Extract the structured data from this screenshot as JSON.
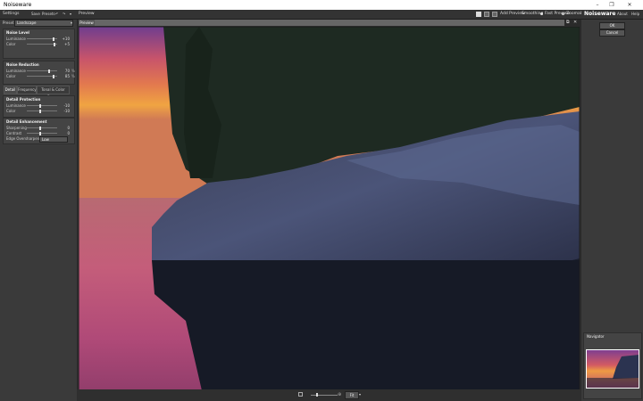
{
  "app": {
    "title": "Noiseware"
  },
  "window_controls": {
    "minimize": "–",
    "maximize": "❐",
    "close": "✕"
  },
  "left_panel": {
    "header": "Settings",
    "save": "Save",
    "presets": "Presets",
    "preset_label": "Preset:",
    "preset_value": "Landscape",
    "noise_level": {
      "title": "Noise Level",
      "rows": [
        {
          "label": "Luminance",
          "value": "+10"
        },
        {
          "label": "Color",
          "value": "+5"
        }
      ]
    },
    "noise_reduction": {
      "title": "Noise Reduction",
      "rows": [
        {
          "label": "Luminance",
          "value": "70",
          "unit": "%"
        },
        {
          "label": "Color",
          "value": "85",
          "unit": "%"
        }
      ]
    },
    "tabs": [
      "Detail",
      "Frequency",
      "Tonal & Color Range"
    ],
    "detail_protection": {
      "title": "Detail Protection",
      "rows": [
        {
          "label": "Luminance",
          "value": "-10"
        },
        {
          "label": "Color",
          "value": "-10"
        }
      ]
    },
    "detail_enhancement": {
      "title": "Detail Enhancement",
      "rows": [
        {
          "label": "Sharpening",
          "value": "0"
        },
        {
          "label": "Contrast",
          "value": "0"
        }
      ],
      "edge_label": "Edge Oversharpening",
      "edge_value": "Low"
    }
  },
  "center": {
    "header": "Preview",
    "toolbar": {
      "add_preview": "Add Preview",
      "smoothing": "Smoothing",
      "fast_preview": "Fast Preview",
      "zoom_sel": "Zoomable"
    },
    "preview_tab": "Preview 1",
    "zoom": "Fit"
  },
  "right_panel": {
    "brand": "Noiseware",
    "about": "About",
    "help": "Help",
    "ok": "OK",
    "cancel": "Cancel",
    "navigator": "Navigator"
  },
  "colors": {
    "accent": "#6a8fb3"
  }
}
